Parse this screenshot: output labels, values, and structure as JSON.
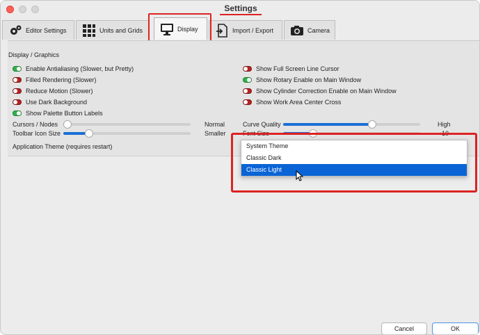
{
  "window": {
    "title": "Settings"
  },
  "tabs": [
    {
      "label": "Editor Settings",
      "icon": "gears-icon"
    },
    {
      "label": "Units and Grids",
      "icon": "grid-icon"
    },
    {
      "label": "Display",
      "icon": "monitor-icon",
      "active": true
    },
    {
      "label": "Import / Export",
      "icon": "import-export-icon"
    },
    {
      "label": "Camera",
      "icon": "camera-icon"
    }
  ],
  "section": {
    "title": "Display / Graphics"
  },
  "left_options": [
    {
      "label": "Enable Antialiasing (Slower, but Pretty)",
      "state": "on"
    },
    {
      "label": "Filled Rendering (Slower)",
      "state": "off"
    },
    {
      "label": "Reduce Motion (Slower)",
      "state": "off"
    },
    {
      "label": "Use Dark Background",
      "state": "off"
    },
    {
      "label": "Show Palette Button Labels",
      "state": "on"
    }
  ],
  "right_options": [
    {
      "label": "Show Full Screen Line Cursor",
      "state": "off"
    },
    {
      "label": "Show Rotary Enable on Main Window",
      "state": "on"
    },
    {
      "label": "Show Cylinder Correction Enable on Main Window",
      "state": "off"
    },
    {
      "label": "Show Work Area Center Cross",
      "state": "off"
    }
  ],
  "sliders": {
    "cursors_nodes": {
      "label": "Cursors / Nodes",
      "value_label": "Normal",
      "level": 0.0
    },
    "toolbar_icon_size": {
      "label": "Toolbar Icon Size",
      "value_label": "Smaller",
      "level": 0.18
    },
    "curve_quality": {
      "label": "Curve Quality",
      "value_label": "High",
      "level": 0.66
    },
    "font_size": {
      "label": "Font Size",
      "value_label": "10",
      "level": 0.2
    }
  },
  "theme": {
    "label": "Application Theme (requires restart)",
    "options": [
      "System Theme",
      "Classic Dark",
      "Classic Light"
    ],
    "selected": "Classic Light"
  },
  "buttons": {
    "cancel": "Cancel",
    "ok": "OK"
  },
  "colors": {
    "toggle_on": "#2fb34a",
    "toggle_off": "#b82222",
    "accent": "#0a64d6",
    "highlight": "#dd2222"
  }
}
